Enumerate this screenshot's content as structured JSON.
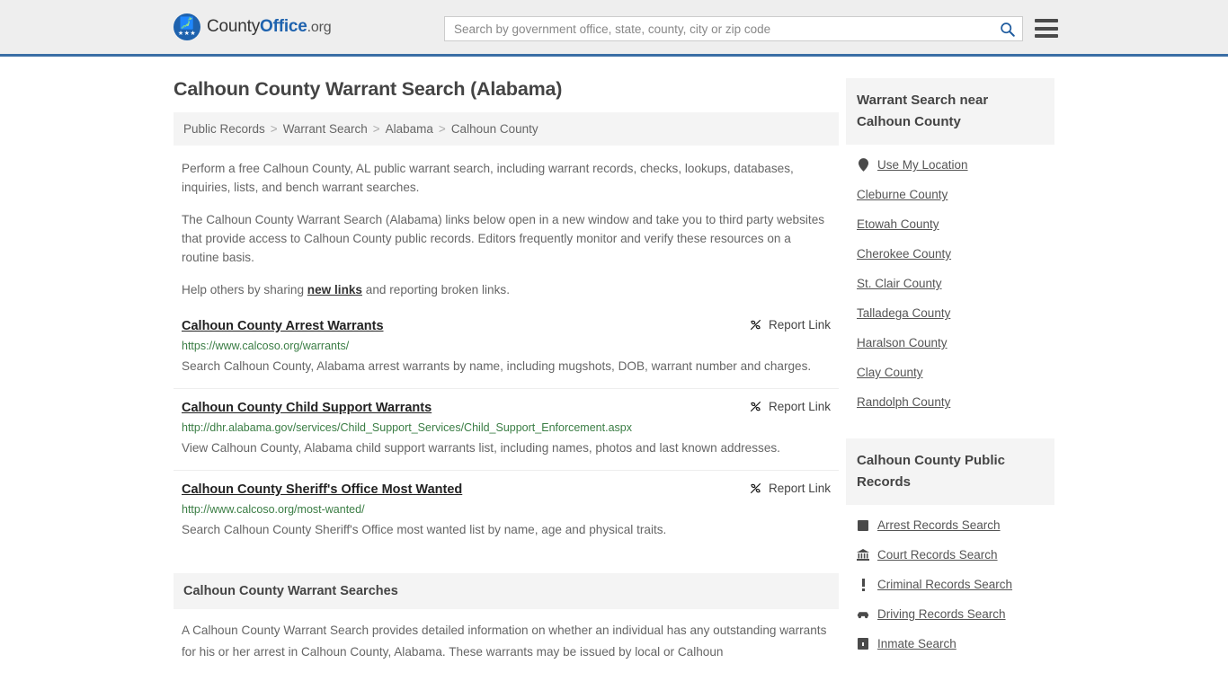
{
  "header": {
    "logo": {
      "text_1": "County",
      "text_2": "Office",
      "text_3": ".org",
      "badge_icon": "eagle-emblem-icon",
      "stars": "★★★"
    },
    "search": {
      "placeholder": "Search by government office, state, county, city or zip code",
      "value": "",
      "button_icon": "search-icon"
    },
    "menu_icon": "hamburger-menu-icon",
    "accent_color": "#3a6ea5"
  },
  "page_title": "Calhoun County Warrant Search (Alabama)",
  "breadcrumb": {
    "items": [
      "Public Records",
      "Warrant Search",
      "Alabama",
      "Calhoun County"
    ],
    "separator": ">"
  },
  "intro": {
    "p1": "Perform a free Calhoun County, AL public warrant search, including warrant records, checks, lookups, databases, inquiries, lists, and bench warrant searches.",
    "p2": "The Calhoun County Warrant Search (Alabama) links below open in a new window and take you to third party websites that provide access to Calhoun County public records. Editors frequently monitor and verify these resources on a routine basis.",
    "p3_before": "Help others by sharing ",
    "p3_link": "new links",
    "p3_after": " and reporting broken links."
  },
  "report_link_label": "Report Link",
  "report_link_icon": "broken-link-icon",
  "results": [
    {
      "title": "Calhoun County Arrest Warrants",
      "url": "https://www.calcoso.org/warrants/",
      "description": "Search Calhoun County, Alabama arrest warrants by name, including mugshots, DOB, warrant number and charges."
    },
    {
      "title": "Calhoun County Child Support Warrants",
      "url": "http://dhr.alabama.gov/services/Child_Support_Services/Child_Support_Enforcement.aspx",
      "description": "View Calhoun County, Alabama child support warrants list, including names, photos and last known addresses."
    },
    {
      "title": "Calhoun County Sheriff's Office Most Wanted",
      "url": "http://www.calcoso.org/most-wanted/",
      "description": "Search Calhoun County Sheriff's Office most wanted list by name, age and physical traits."
    }
  ],
  "bottom_section": {
    "heading": "Calhoun County Warrant Searches",
    "paragraph": "A Calhoun County Warrant Search provides detailed information on whether an individual has any outstanding warrants for his or her arrest in Calhoun County, Alabama. These warrants may be issued by local or Calhoun"
  },
  "sidebar": {
    "nearby": {
      "heading": "Warrant Search near Calhoun County",
      "use_my_location": {
        "label": "Use My Location",
        "icon": "map-pin-icon"
      },
      "counties": [
        "Cleburne County",
        "Etowah County",
        "Cherokee County",
        "St. Clair County",
        "Talladega County",
        "Haralson County",
        "Clay County",
        "Randolph County"
      ]
    },
    "public_records": {
      "heading": "Calhoun County Public Records",
      "items": [
        {
          "label": "Arrest Records Search",
          "icon": "fingerprint-icon"
        },
        {
          "label": "Court Records Search",
          "icon": "courthouse-icon"
        },
        {
          "label": "Criminal Records Search",
          "icon": "exclamation-icon"
        },
        {
          "label": "Driving Records Search",
          "icon": "car-icon"
        },
        {
          "label": "Inmate Search",
          "icon": "jail-door-icon"
        }
      ]
    }
  }
}
